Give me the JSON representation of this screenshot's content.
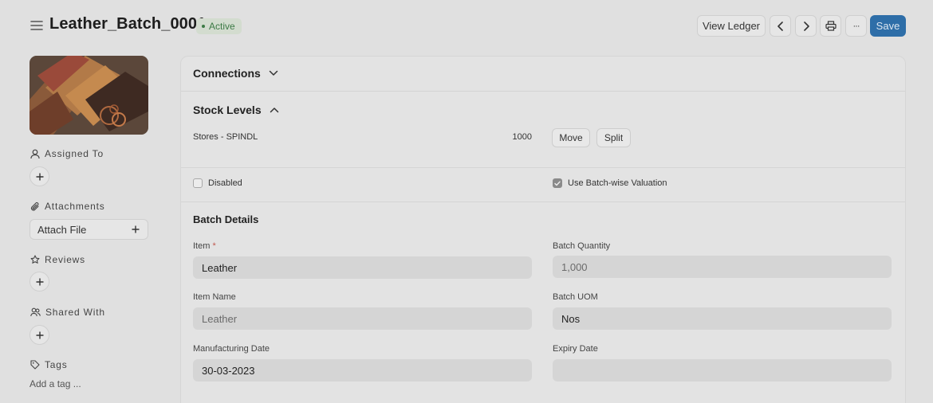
{
  "header": {
    "title": "Leather_Batch_0001",
    "status": "Active",
    "view_ledger_label": "View Ledger",
    "save_label": "Save",
    "more_label": "···"
  },
  "sidebar": {
    "assigned_to_label": "Assigned To",
    "attachments_label": "Attachments",
    "attach_file_label": "Attach File",
    "reviews_label": "Reviews",
    "shared_with_label": "Shared With",
    "tags_label": "Tags",
    "add_tag_label": "Add a tag ..."
  },
  "sections": {
    "connections_label": "Connections",
    "stock_levels_label": "Stock Levels"
  },
  "stock": {
    "warehouse": "Stores - SPINDL",
    "qty": "1000",
    "move_label": "Move",
    "split_label": "Split"
  },
  "checks": {
    "disabled_label": "Disabled",
    "disabled_checked": false,
    "batch_valuation_label": "Use Batch-wise Valuation",
    "batch_valuation_checked": true
  },
  "batch_details": {
    "title": "Batch Details",
    "item_label": "Item",
    "item_required": "*",
    "item_value": "Leather",
    "item_name_label": "Item Name",
    "item_name_value": "Leather",
    "mfg_date_label": "Manufacturing Date",
    "mfg_date_value": "30-03-2023",
    "batch_qty_label": "Batch Quantity",
    "batch_qty_value": "1,000",
    "batch_uom_label": "Batch UOM",
    "batch_uom_value": "Nos",
    "expiry_date_label": "Expiry Date",
    "expiry_date_value": ""
  },
  "colors": {
    "primary": "#2e6ea8",
    "status_green": "#3c7a45",
    "background": "#e0e0e0"
  }
}
